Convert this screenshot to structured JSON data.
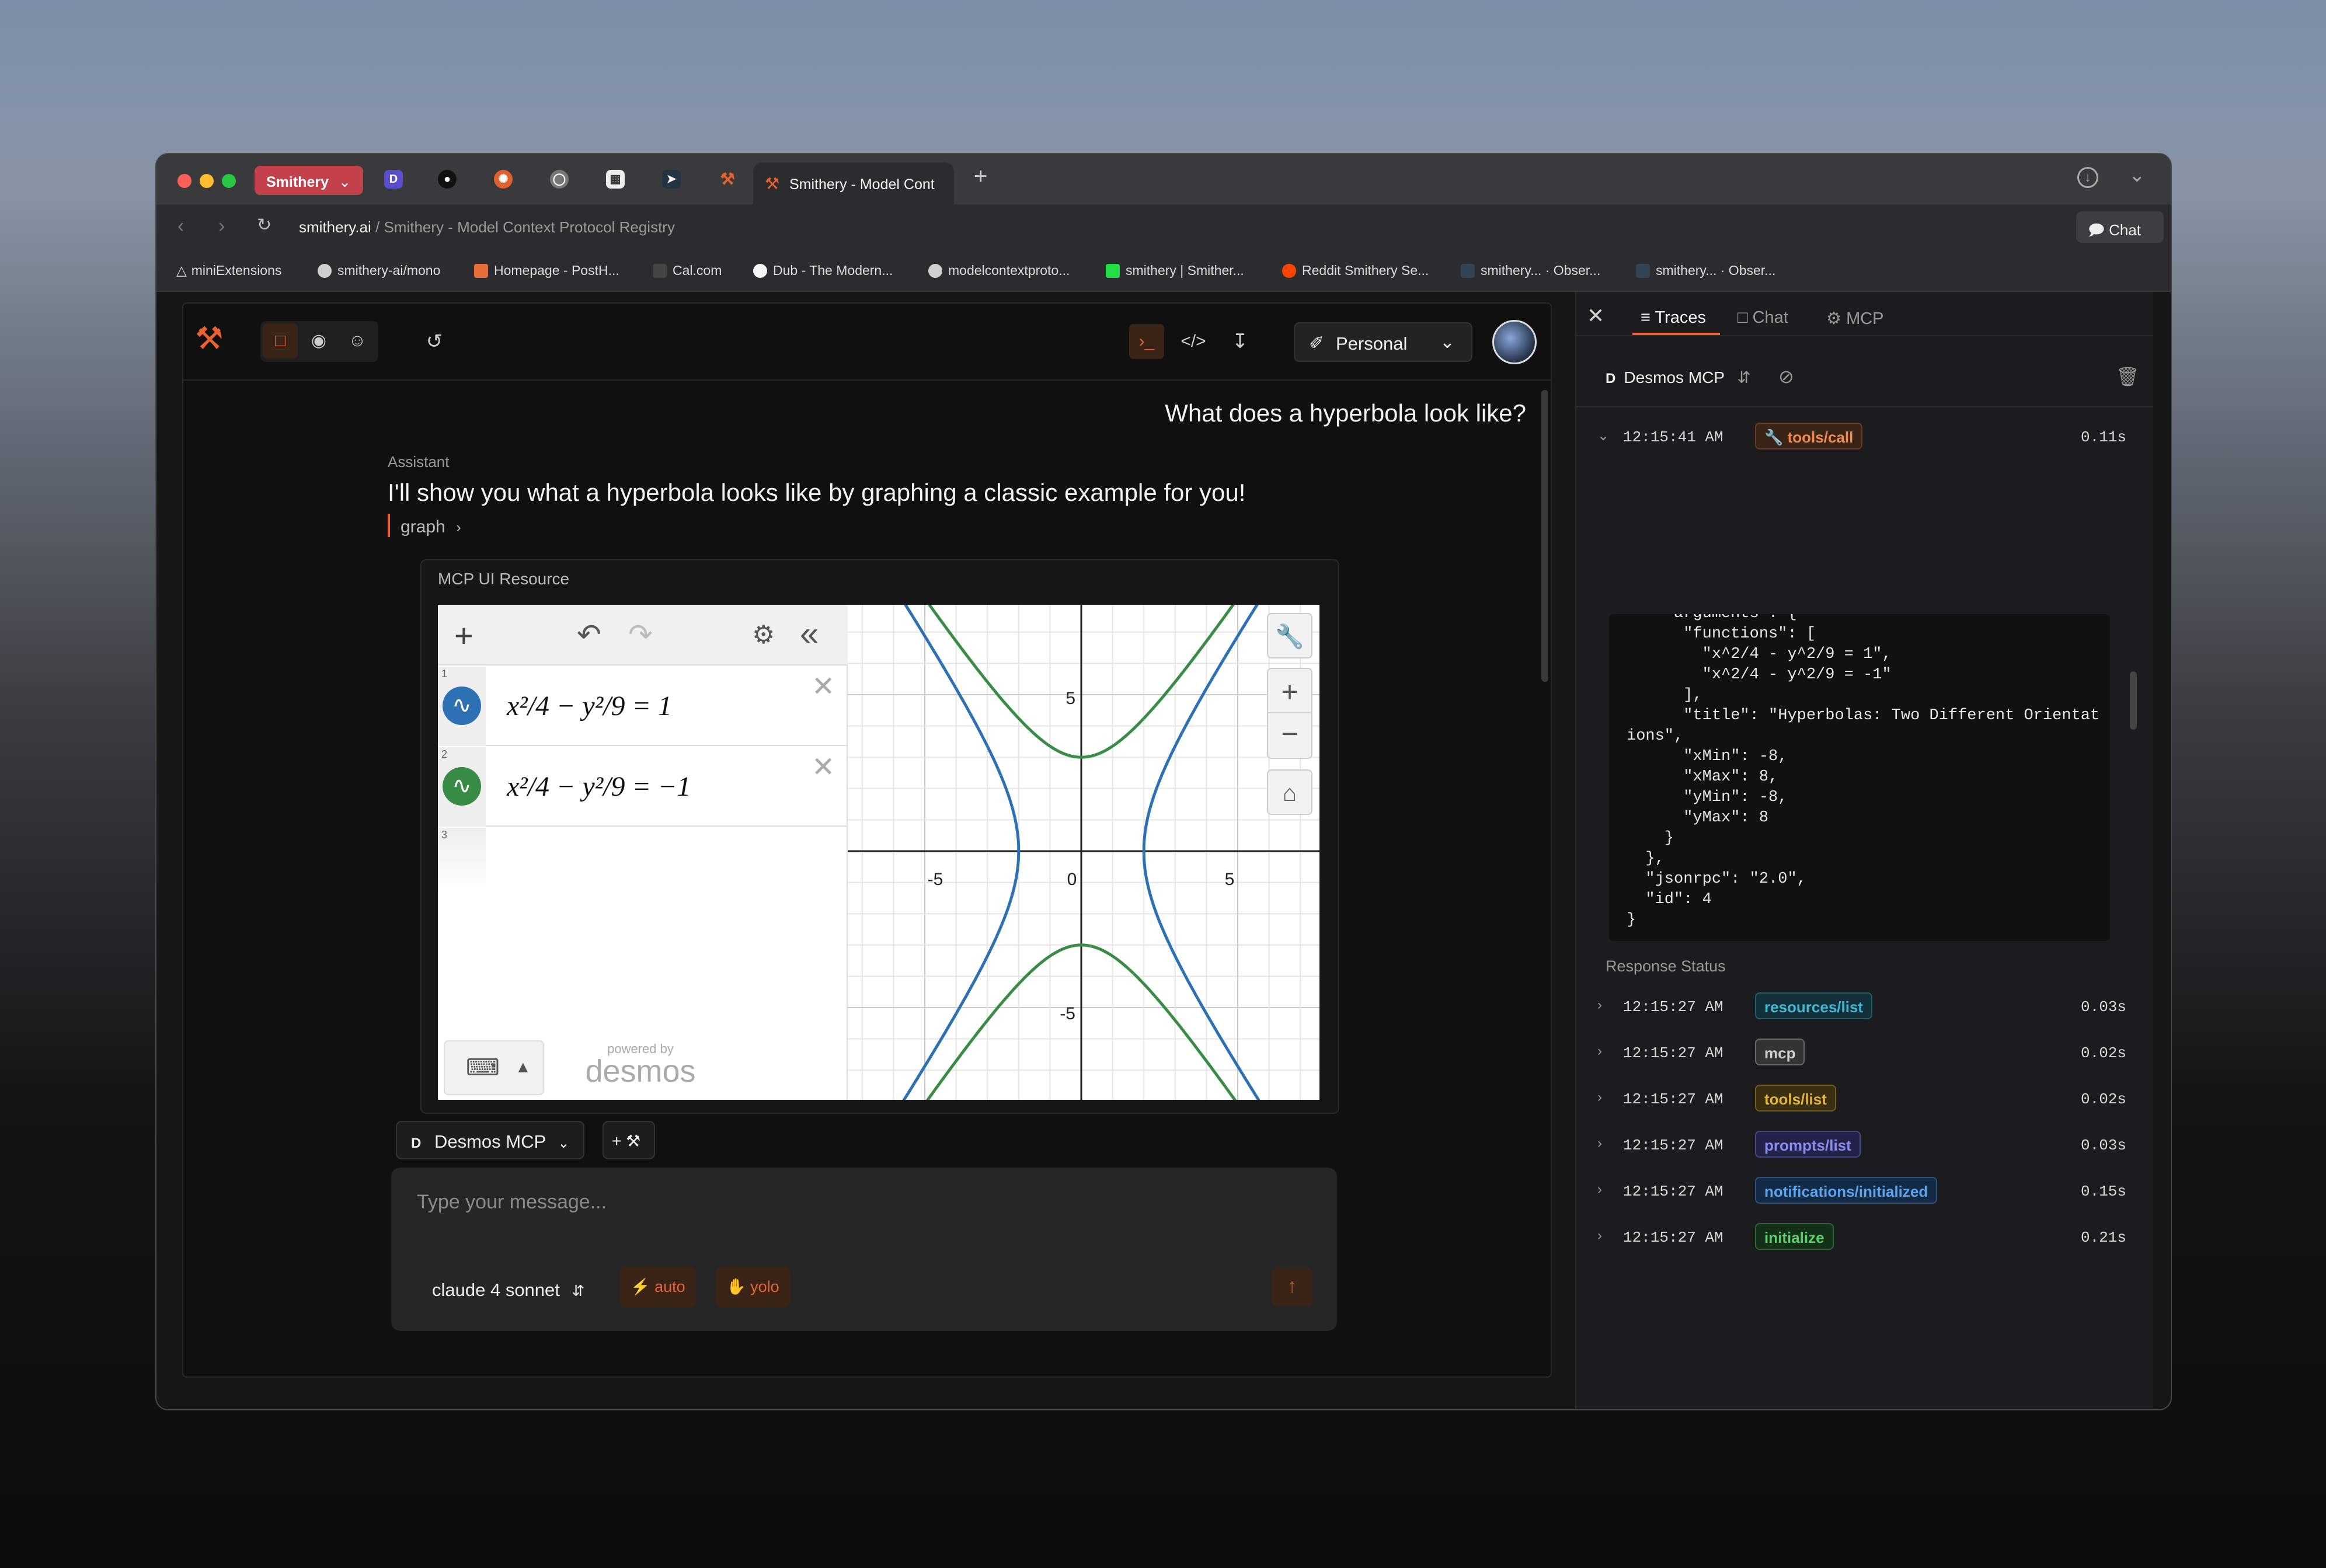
{
  "browser": {
    "profile_tab_label": "Smithery",
    "active_tab_title": "Smithery - Model Cont",
    "new_tab_symbol": "+",
    "url_domain": "smithery.ai",
    "url_path": " / Smithery - Model Context Protocol Registry",
    "chat_button": "Chat",
    "bookmarks": [
      "miniExtensions",
      "smithery-ai/mono",
      "Homepage - PostH...",
      "Cal.com",
      "Dub - The Modern...",
      "modelcontextproto...",
      "smithery | Smither...",
      "Reddit Smithery Se...",
      "smithery... · Obser...",
      "smithery... · Obser..."
    ]
  },
  "toolbar": {
    "workspace_label": "Personal"
  },
  "chat": {
    "user_message": "What does a hyperbola look like?",
    "assistant_label": "Assistant",
    "assistant_message": "I'll show you what a hyperbola looks like by graphing a classic example for you!",
    "tool_ref": "graph",
    "resource_title": "MCP UI Resource",
    "server_chip": "Desmos MCP",
    "server_initial": "D",
    "add_tool": "+",
    "input_placeholder": "Type your message...",
    "model": "claude 4 sonnet",
    "mode_auto": "auto",
    "mode_yolo": "yolo"
  },
  "desmos": {
    "expressions": [
      {
        "index": "1",
        "latex": "x²/4 − y²/9 = 1",
        "color": "#2d70b3"
      },
      {
        "index": "2",
        "latex": "x²/4 − y²/9 = −1",
        "color": "#388c46"
      },
      {
        "index": "3",
        "latex": "",
        "color": ""
      }
    ],
    "powered_by": "powered by",
    "brand": "desmos",
    "tick_labels": {
      "x_neg5": "-5",
      "x_0": "0",
      "x_5": "5",
      "y_5": "5",
      "y_neg5": "-5"
    }
  },
  "chart_data": {
    "type": "line",
    "title": "",
    "xlim": [
      -8,
      8
    ],
    "ylim": [
      -8,
      8
    ],
    "grid": true,
    "series": [
      {
        "equation": "x^2/4 - y^2/9 = 1",
        "color": "#2d70b3"
      },
      {
        "equation": "x^2/4 - y^2/9 = -1",
        "color": "#388c46"
      }
    ]
  },
  "side": {
    "tabs": [
      "Traces",
      "Chat",
      "MCP"
    ],
    "server": "Desmos MCP",
    "server_initial": "D",
    "expanded": {
      "time": "12:15:41 AM",
      "method": "tools/call",
      "duration": "0.11s"
    },
    "code_lines": [
      "    \"arguments\": {",
      "      \"functions\": [",
      "        \"x^2/4 - y^2/9 = 1\",",
      "        \"x^2/4 - y^2/9 = -1\"",
      "      ],",
      "      \"title\": \"Hyperbolas: Two Different Orientat",
      "ions\",",
      "      \"xMin\": -8,",
      "      \"xMax\": 8,",
      "      \"yMin\": -8,",
      "      \"yMax\": 8",
      "    }",
      "  },",
      "  \"jsonrpc\": \"2.0\",",
      "  \"id\": 4",
      "}"
    ],
    "response_status": "Response Status",
    "traces": [
      {
        "time": "12:15:27 AM",
        "method": "resources/list",
        "duration": "0.03s",
        "color": "#3fb8d6",
        "bg": "#123038"
      },
      {
        "time": "12:15:27 AM",
        "method": "mcp",
        "duration": "0.02s",
        "color": "#d0d0d0",
        "bg": "#333"
      },
      {
        "time": "12:15:27 AM",
        "method": "tools/list",
        "duration": "0.02s",
        "color": "#e3b33c",
        "bg": "#3a2f10"
      },
      {
        "time": "12:15:27 AM",
        "method": "prompts/list",
        "duration": "0.03s",
        "color": "#8c8cf0",
        "bg": "#23234a"
      },
      {
        "time": "12:15:27 AM",
        "method": "notifications/initialized",
        "duration": "0.15s",
        "color": "#5aa4f0",
        "bg": "#142a44"
      },
      {
        "time": "12:15:27 AM",
        "method": "initialize",
        "duration": "0.21s",
        "color": "#5cd06a",
        "bg": "#143018"
      }
    ]
  }
}
